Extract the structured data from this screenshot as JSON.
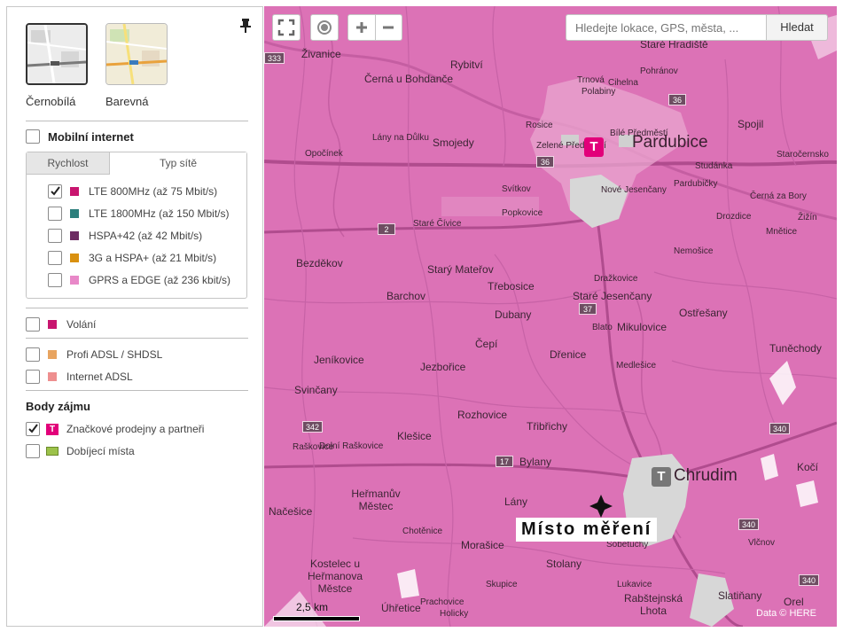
{
  "sidebar": {
    "map_styles": [
      {
        "label": "Černobílá",
        "selected": true
      },
      {
        "label": "Barevná",
        "selected": false
      }
    ],
    "mobile_internet": {
      "label": "Mobilní internet",
      "checked": false,
      "tabs": [
        "Rychlost",
        "Typ sítě"
      ],
      "items": [
        {
          "label": "LTE 800MHz (až 75 Mbit/s)",
          "color": "#c8156f",
          "checked": true
        },
        {
          "label": "LTE 1800MHz (až 150 Mbit/s)",
          "color": "#2c7f7c",
          "checked": false
        },
        {
          "label": "HSPA+42 (až 42 Mbit/s)",
          "color": "#6d2c63",
          "checked": false
        },
        {
          "label": "3G a HSPA+ (až 21 Mbit/s)",
          "color": "#d9900f",
          "checked": false
        },
        {
          "label": "GPRS a EDGE (až 236 kbit/s)",
          "color": "#e888c8",
          "checked": false
        }
      ]
    },
    "voice": {
      "label": "Volání",
      "color": "#c8156f",
      "checked": false
    },
    "fixed": [
      {
        "label": "Profi ADSL / SHDSL",
        "color": "#e8a460",
        "checked": false
      },
      {
        "label": "Internet ADSL",
        "color": "#ee8f8f",
        "checked": false
      }
    ],
    "poi": {
      "heading": "Body zájmu",
      "items": [
        {
          "label": "Značkové prodejny a partneři",
          "checked": true,
          "icon": "t-mobile-icon"
        },
        {
          "label": "Dobíjecí místa",
          "checked": false,
          "icon": "recharge-card-icon"
        }
      ]
    }
  },
  "map": {
    "search_placeholder": "Hledejte lokace, GPS, města, ...",
    "search_button": "Hledat",
    "coverage_color": "#dc72b6",
    "brand_color": "#e2007a",
    "places": [
      {
        "name": "Živanice"
      },
      {
        "name": "Rybitví"
      },
      {
        "name": "Černá u Bohdanče"
      },
      {
        "name": "Trnová"
      },
      {
        "name": "Pohránov"
      },
      {
        "name": "Polabiny"
      },
      {
        "name": "Cihelna"
      },
      {
        "name": "Staré Hradiště"
      },
      {
        "name": "Spojil"
      },
      {
        "name": "Lány na Důlku"
      },
      {
        "name": "Rosice"
      },
      {
        "name": "Bílé Předměstí"
      },
      {
        "name": "Smojedy"
      },
      {
        "name": "Opočínek"
      },
      {
        "name": "Zelené Předměstí"
      },
      {
        "name": "Pardubice"
      },
      {
        "name": "Studánka"
      },
      {
        "name": "Staročernsko"
      },
      {
        "name": "Svítkov"
      },
      {
        "name": "Pardubičky"
      },
      {
        "name": "Nové Jesenčany"
      },
      {
        "name": "Černá za Bory"
      },
      {
        "name": "Popkovice"
      },
      {
        "name": "Staré Čívice"
      },
      {
        "name": "Drozdice"
      },
      {
        "name": "Žižín"
      },
      {
        "name": "Mněticе"
      },
      {
        "name": "Nemošice"
      },
      {
        "name": "Bezděkov"
      },
      {
        "name": "Starý Mateřov"
      },
      {
        "name": "Třebosice"
      },
      {
        "name": "Dražkovice"
      },
      {
        "name": "Barchov"
      },
      {
        "name": "Staré Jesenčany"
      },
      {
        "name": "Dubany"
      },
      {
        "name": "Ostřešany"
      },
      {
        "name": "Blato"
      },
      {
        "name": "Mikulovice"
      },
      {
        "name": "Čepí"
      },
      {
        "name": "Tuněchody"
      },
      {
        "name": "Jeníkovice"
      },
      {
        "name": "Jezbořice"
      },
      {
        "name": "Dřenice"
      },
      {
        "name": "Medlešice"
      },
      {
        "name": "Svinčany"
      },
      {
        "name": "Rozhovice"
      },
      {
        "name": "Třibřichy"
      },
      {
        "name": "Klešice"
      },
      {
        "name": "Raškovice"
      },
      {
        "name": "Dolní Raškovice"
      },
      {
        "name": "Bylany"
      },
      {
        "name": "Chrudim"
      },
      {
        "name": "Kočí"
      },
      {
        "name": "Heřmanův Městec"
      },
      {
        "name": "Lány"
      },
      {
        "name": "Načešice"
      },
      {
        "name": "Chotěnice"
      },
      {
        "name": "Morašice"
      },
      {
        "name": "Sobětuchy"
      },
      {
        "name": "Vlčnov"
      },
      {
        "name": "Kostelec u Heřmanova Městce"
      },
      {
        "name": "Stolany"
      },
      {
        "name": "Slatiňany"
      },
      {
        "name": "Orel"
      },
      {
        "name": "Úhřetice"
      },
      {
        "name": "Rabštejnská Lhota"
      },
      {
        "name": "Skupice"
      },
      {
        "name": "Lukavice"
      },
      {
        "name": "Prachovice"
      },
      {
        "name": "Holicky"
      }
    ],
    "road_shields": [
      "333",
      "36",
      "36",
      "2",
      "37",
      "342",
      "17",
      "340",
      "340",
      "340"
    ],
    "annotation": "Místo měření",
    "scale": "2,5 km",
    "attribution": "Data © HERE"
  }
}
